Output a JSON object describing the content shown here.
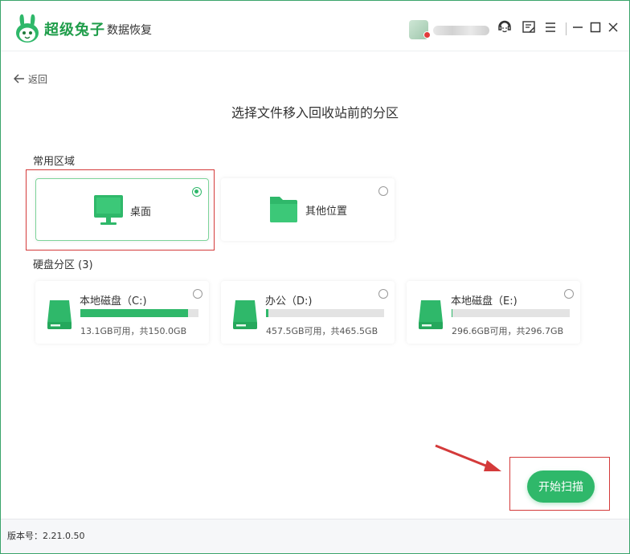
{
  "app": {
    "brand": "超级兔子",
    "subtitle": "数据恢复"
  },
  "nav": {
    "back_label": "返回"
  },
  "page": {
    "title": "选择文件移入回收站前的分区"
  },
  "common_areas": {
    "label": "常用区域",
    "items": [
      {
        "label": "桌面",
        "selected": true,
        "icon": "monitor-icon"
      },
      {
        "label": "其他位置",
        "selected": false,
        "icon": "folder-icon"
      }
    ]
  },
  "disks": {
    "label": "硬盘分区 (3)",
    "items": [
      {
        "name": "本地磁盘（C:)",
        "capacity": "13.1GB可用，共150.0GB",
        "used_fraction": 0.91,
        "selected": false
      },
      {
        "name": "办公（D:)",
        "capacity": "457.5GB可用，共465.5GB",
        "used_fraction": 0.02,
        "selected": false
      },
      {
        "name": "本地磁盘（E:)",
        "capacity": "296.6GB可用，共296.7GB",
        "used_fraction": 0.01,
        "selected": false
      }
    ]
  },
  "actions": {
    "scan_label": "开始扫描"
  },
  "status": {
    "version": "版本号：2.21.0.50"
  },
  "colors": {
    "accent": "#2fb86a",
    "brand": "#1f9d4a",
    "highlight": "#d43a3a"
  }
}
